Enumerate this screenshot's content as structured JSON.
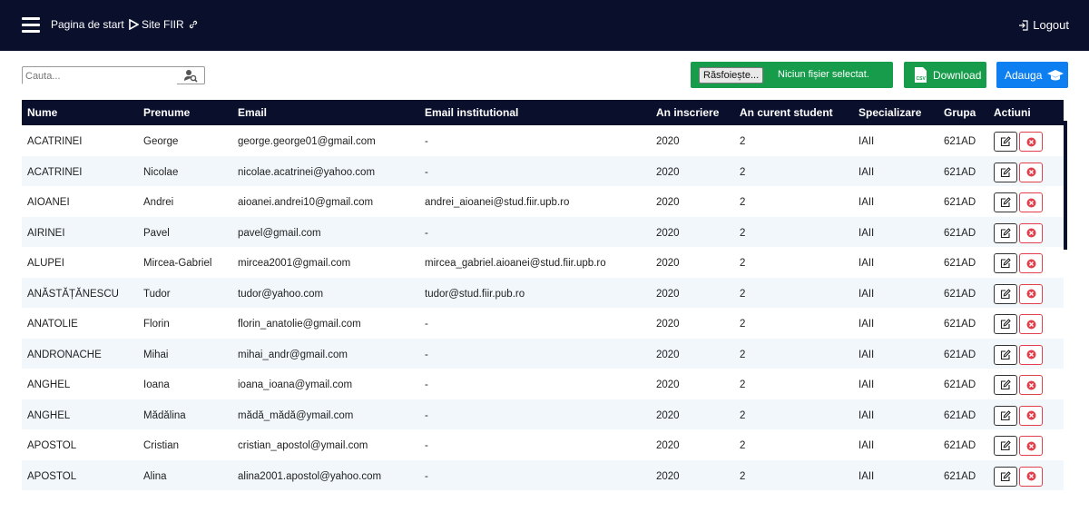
{
  "nav": {
    "start_label": "Pagina de start",
    "site_label": "Site FIIR",
    "logout_label": "Logout"
  },
  "search": {
    "placeholder": "Cauta..."
  },
  "upload": {
    "browse_label": "Răsfoiește...",
    "status": "Niciun fișier selectat."
  },
  "toolbar": {
    "download_label": "Download",
    "add_label": "Adauga"
  },
  "table": {
    "headers": [
      "Nume",
      "Prenume",
      "Email",
      "Email institutional",
      "An inscriere",
      "An curent student",
      "Specializare",
      "Grupa",
      "Actiuni"
    ],
    "rows": [
      [
        "ACATRINEI",
        "George",
        "george.george01@gmail.com",
        "-",
        "2020",
        "2",
        "IAII",
        "621AD"
      ],
      [
        "ACATRINEI",
        "Nicolae",
        "nicolae.acatrinei@yahoo.com",
        "-",
        "2020",
        "2",
        "IAII",
        "621AD"
      ],
      [
        "AIOANEI",
        "Andrei",
        "aioanei.andrei10@gmail.com",
        "andrei_aioanei@stud.fiir.upb.ro",
        "2020",
        "2",
        "IAII",
        "621AD"
      ],
      [
        "AIRINEI",
        "Pavel",
        "pavel@gmail.com",
        "-",
        "2020",
        "2",
        "IAII",
        "621AD"
      ],
      [
        "ALUPEI",
        "Mircea-Gabriel",
        "mircea2001@gmail.com",
        "mircea_gabriel.aioanei@stud.fiir.upb.ro",
        "2020",
        "2",
        "IAII",
        "621AD"
      ],
      [
        "ANĂSTĂȚĂNESCU",
        "Tudor",
        "tudor@yahoo.com",
        "tudor@stud.fiir.pub.ro",
        "2020",
        "2",
        "IAII",
        "621AD"
      ],
      [
        "ANATOLIE",
        "Florin",
        "florin_anatolie@gmail.com",
        "-",
        "2020",
        "2",
        "IAII",
        "621AD"
      ],
      [
        "ANDRONACHE",
        "Mihai",
        "mihai_andr@gmail.com",
        "-",
        "2020",
        "2",
        "IAII",
        "621AD"
      ],
      [
        "ANGHEL",
        "Ioana",
        "ioana_ioana@ymail.com",
        "-",
        "2020",
        "2",
        "IAII",
        "621AD"
      ],
      [
        "ANGHEL",
        "Mădălina",
        "mădă_mădă@ymail.com",
        "-",
        "2020",
        "2",
        "IAII",
        "621AD"
      ],
      [
        "APOSTOL",
        "Cristian",
        "cristian_apostol@ymail.com",
        "-",
        "2020",
        "2",
        "IAII",
        "621AD"
      ],
      [
        "APOSTOL",
        "Alina",
        "alina2001.apostol@yahoo.com",
        "-",
        "2020",
        "2",
        "IAII",
        "621AD"
      ]
    ]
  },
  "colors": {
    "navbar": "#0a0f2c",
    "green": "#169c4b",
    "blue": "#0d7ff0",
    "danger": "#e0404c",
    "row_alt": "#f2f7fb"
  },
  "icons": {
    "menu": "hamburger-icon",
    "start": "play-triangle-icon",
    "site": "link-icon",
    "logout": "logout-icon",
    "search": "user-search-icon",
    "download": "csv-file-icon",
    "add": "graduation-cap-icon",
    "edit": "edit-icon",
    "delete": "delete-icon"
  }
}
